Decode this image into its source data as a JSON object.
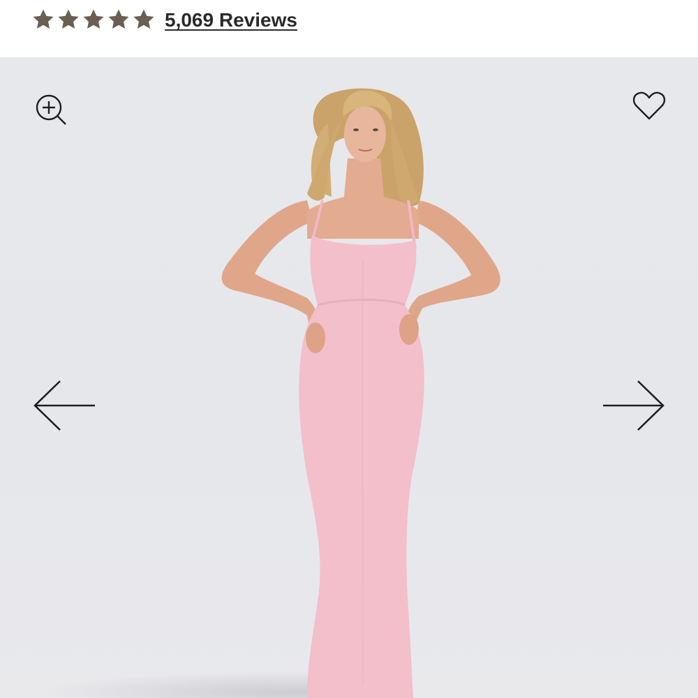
{
  "rating": {
    "stars": 5,
    "filled_stars": 5,
    "star_color": "#6b5e53",
    "reviews_label": "5,069 Reviews"
  },
  "gallery": {
    "background_color": "#e7e8ec",
    "product_color": "#f2bfcb",
    "icons": {
      "zoom": "zoom-in-icon",
      "favorite": "heart-icon",
      "previous": "arrow-left-icon",
      "next": "arrow-right-icon"
    }
  }
}
